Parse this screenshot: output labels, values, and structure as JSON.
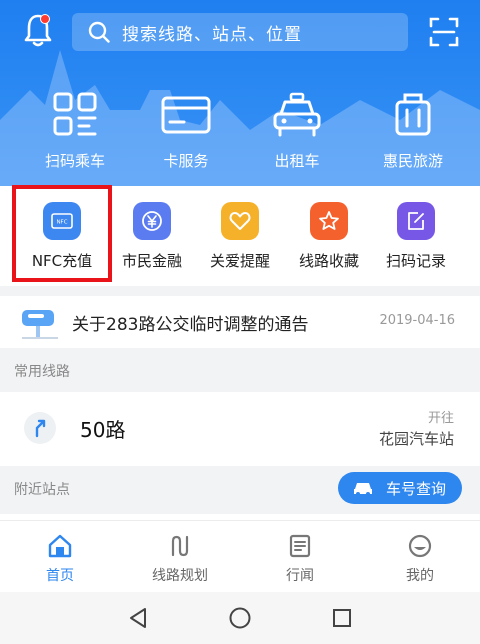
{
  "header": {
    "search_placeholder": "搜索线路、站点、位置",
    "top_features": [
      {
        "label": "扫码乘车",
        "icon": "qr-code-icon"
      },
      {
        "label": "卡服务",
        "icon": "card-icon"
      },
      {
        "label": "出租车",
        "icon": "taxi-icon"
      },
      {
        "label": "惠民旅游",
        "icon": "luggage-icon"
      }
    ]
  },
  "services": [
    {
      "label": "NFC充值",
      "icon": "nfc-icon",
      "color": "#3d87f0"
    },
    {
      "label": "市民金融",
      "icon": "yen-icon",
      "color": "#5b7cf0"
    },
    {
      "label": "关爱提醒",
      "icon": "heart-icon",
      "color": "#f6b12a"
    },
    {
      "label": "线路收藏",
      "icon": "star-icon",
      "color": "#f4612d"
    },
    {
      "label": "扫码记录",
      "icon": "edit-note-icon",
      "color": "#7657e6"
    }
  ],
  "notice": {
    "text": "关于283路公交临时调整的通告",
    "date": "2019-04-16"
  },
  "frequent": {
    "title": "常用线路",
    "route": {
      "number": "50路",
      "direction_label": "开往",
      "destination": "花园汽车站"
    }
  },
  "nearby": {
    "title": "附近站点",
    "bus_query_label": "车号查询"
  },
  "bottom_nav": [
    {
      "label": "首页",
      "icon": "home-icon",
      "active": true
    },
    {
      "label": "线路规划",
      "icon": "route-plan-icon",
      "active": false
    },
    {
      "label": "行闻",
      "icon": "news-icon",
      "active": false
    },
    {
      "label": "我的",
      "icon": "profile-icon",
      "active": false
    }
  ],
  "colors": {
    "brand": "#2e86ef",
    "highlight": "#e8141a"
  }
}
